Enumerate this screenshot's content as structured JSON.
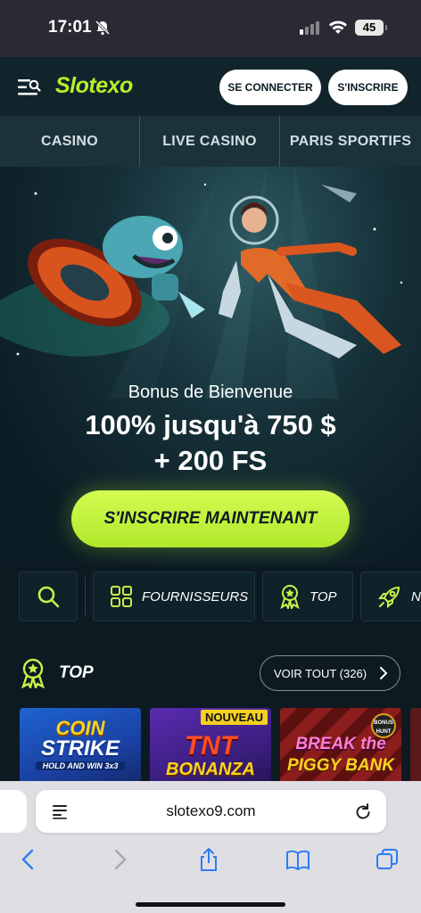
{
  "status_bar": {
    "time": "17:01",
    "battery": "45"
  },
  "header": {
    "logo": "Slotexo",
    "login_label": "SE CONNECTER",
    "register_label": "S'INSCRIRE"
  },
  "nav_tabs": [
    "CASINO",
    "LIVE CASINO",
    "PARIS SPORTIFS"
  ],
  "hero": {
    "bonus_subtitle": "Bonus de Bienvenue",
    "bonus_line1": "100% jusqu'à 750 $",
    "bonus_line2": "+ 200 FS",
    "cta_label": "S'INSCRIRE MAINTENANT"
  },
  "filters": {
    "providers_label": "FOURNISSEURS",
    "top_label": "TOP",
    "new_label": "NO"
  },
  "top_section": {
    "title": "TOP",
    "view_all_label": "VOIR TOUT (326)"
  },
  "games": [
    {
      "name_line1": "COIN",
      "name_line2": "STRIKE",
      "name_line3": "HOLD AND WIN 3x3"
    },
    {
      "badge": "NOUVEAU",
      "name_line1": "TNT",
      "name_line2": "BONANZA"
    },
    {
      "name_line1": "BREAK the",
      "name_line2": "PIGGY BANK",
      "badge2": "BONUS HUNT"
    }
  ],
  "browser": {
    "url": "slotexo9.com"
  },
  "colors": {
    "accent": "#b6ef2c",
    "header_bg": "#11242c",
    "tab_bg": "#1b323b"
  }
}
